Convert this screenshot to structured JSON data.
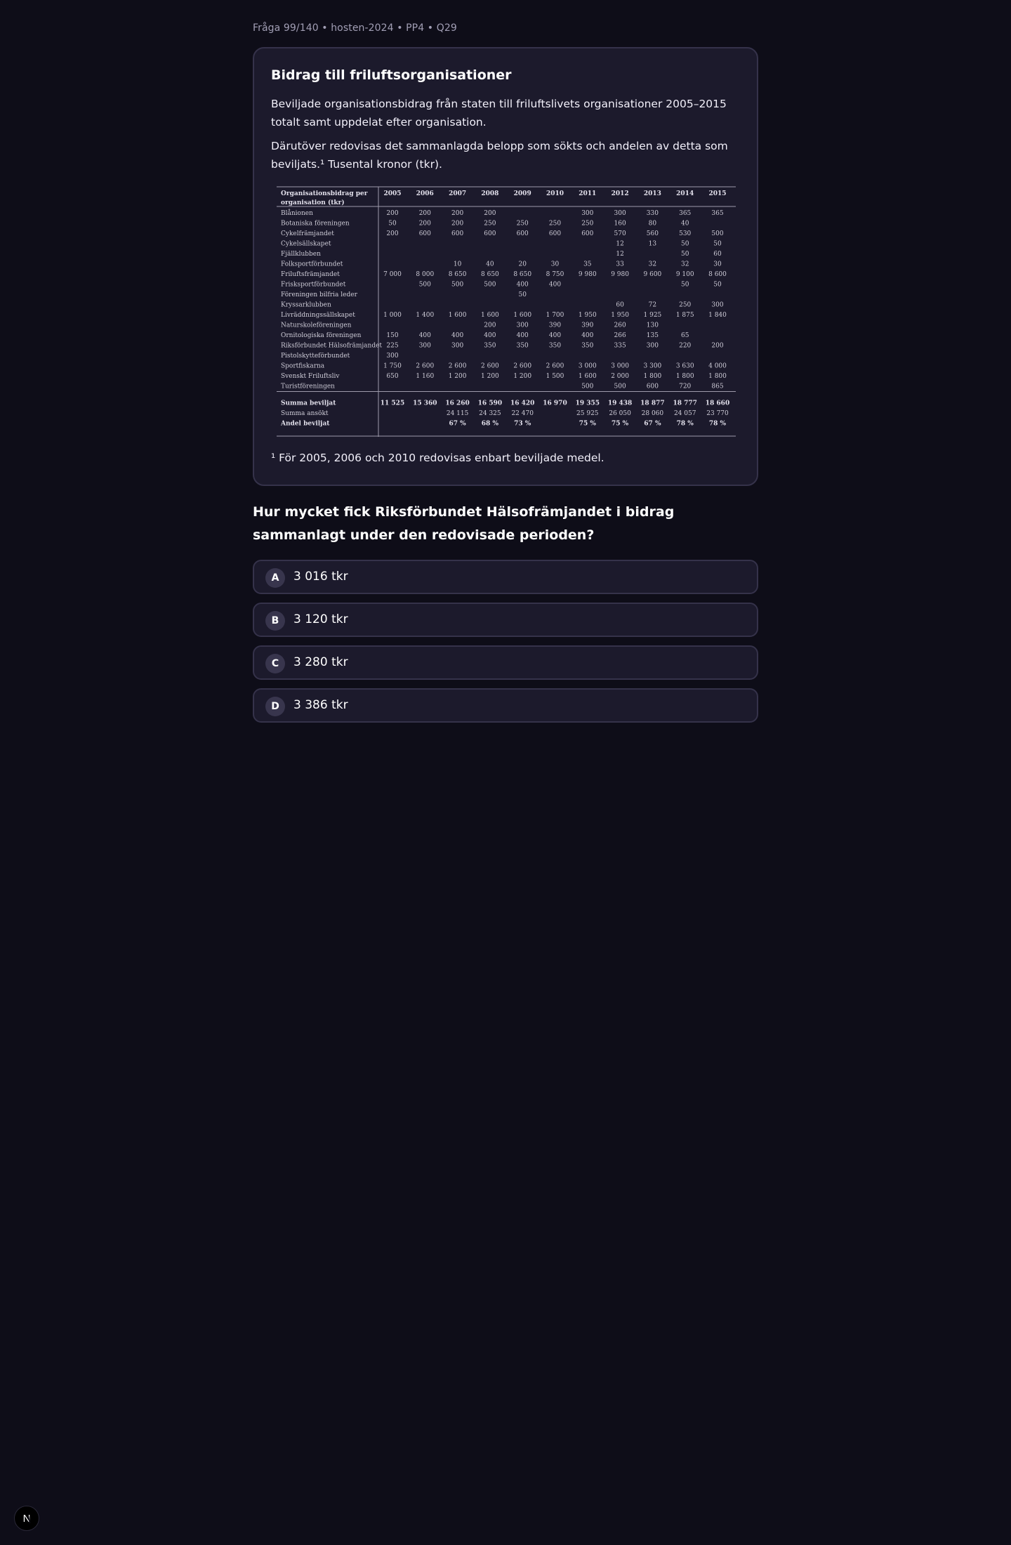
{
  "meta": "Fråga 99/140 • hosten-2024 • PP4 • Q29",
  "card": {
    "title": "Bidrag till friluftsorganisationer",
    "paragraph1": "Beviljade organisationsbidrag från staten till friluftslivets organisationer 2005–2015 totalt samt uppdelat efter organisation.",
    "paragraph2": "Därutöver redovisas det sammanlagda belopp som sökts och andelen av detta som beviljats.¹ Tusental kronor (tkr).",
    "footnote": "¹ För 2005, 2006 och 2010 redovisas enbart beviljade medel."
  },
  "table": {
    "header_line1": "Organisationsbidrag per",
    "header_line2": "organisation  (tkr)",
    "years": [
      "2005",
      "2006",
      "2007",
      "2008",
      "2009",
      "2010",
      "2011",
      "2012",
      "2013",
      "2014",
      "2015"
    ],
    "rows": [
      {
        "name": "Blånionen",
        "values": [
          "200",
          "200",
          "200",
          "200",
          "",
          "",
          "300",
          "300",
          "330",
          "365",
          "365"
        ]
      },
      {
        "name": "Botaniska föreningen",
        "values": [
          "50",
          "200",
          "200",
          "250",
          "250",
          "250",
          "250",
          "160",
          "80",
          "40",
          ""
        ]
      },
      {
        "name": "Cykelfrämjandet",
        "values": [
          "200",
          "600",
          "600",
          "600",
          "600",
          "600",
          "600",
          "570",
          "560",
          "530",
          "500"
        ]
      },
      {
        "name": "Cykelsällskapet",
        "values": [
          "",
          "",
          "",
          "",
          "",
          "",
          "",
          "12",
          "13",
          "50",
          "50"
        ]
      },
      {
        "name": "Fjällklubben",
        "values": [
          "",
          "",
          "",
          "",
          "",
          "",
          "",
          "12",
          "",
          "50",
          "60"
        ]
      },
      {
        "name": "Folksportförbundet",
        "values": [
          "",
          "",
          "10",
          "40",
          "20",
          "30",
          "35",
          "33",
          "32",
          "32",
          "30"
        ]
      },
      {
        "name": "Friluftsfrämjandet",
        "values": [
          "7 000",
          "8 000",
          "8 650",
          "8 650",
          "8 650",
          "8 750",
          "9 980",
          "9 980",
          "9 600",
          "9 100",
          "8 600"
        ]
      },
      {
        "name": "Frisksportförbundet",
        "values": [
          "",
          "500",
          "500",
          "500",
          "400",
          "400",
          "",
          "",
          "",
          "50",
          "50"
        ]
      },
      {
        "name": "Föreningen bilfria leder",
        "values": [
          "",
          "",
          "",
          "",
          "50",
          "",
          "",
          "",
          "",
          "",
          ""
        ]
      },
      {
        "name": "Kryssarklubben",
        "values": [
          "",
          "",
          "",
          "",
          "",
          "",
          "",
          "60",
          "72",
          "250",
          "300"
        ]
      },
      {
        "name": "Livräddningssällskapet",
        "values": [
          "1 000",
          "1 400",
          "1 600",
          "1 600",
          "1 600",
          "1 700",
          "1 950",
          "1 950",
          "1 925",
          "1 875",
          "1 840"
        ]
      },
      {
        "name": "Naturskoleföreningen",
        "values": [
          "",
          "",
          "",
          "200",
          "300",
          "390",
          "390",
          "260",
          "130",
          "",
          ""
        ]
      },
      {
        "name": "Ornitologiska föreningen",
        "values": [
          "150",
          "400",
          "400",
          "400",
          "400",
          "400",
          "400",
          "266",
          "135",
          "65",
          ""
        ]
      },
      {
        "name": "Riksförbundet Hälsofrämjandet",
        "values": [
          "225",
          "300",
          "300",
          "350",
          "350",
          "350",
          "350",
          "335",
          "300",
          "220",
          "200"
        ]
      },
      {
        "name": "Pistolskytteförbundet",
        "values": [
          "300",
          "",
          "",
          "",
          "",
          "",
          "",
          "",
          "",
          "",
          ""
        ]
      },
      {
        "name": "Sportfiskarna",
        "values": [
          "1 750",
          "2 600",
          "2 600",
          "2 600",
          "2 600",
          "2 600",
          "3 000",
          "3 000",
          "3 300",
          "3 630",
          "4 000"
        ]
      },
      {
        "name": "Svenskt Friluftsliv",
        "values": [
          "650",
          "1 160",
          "1 200",
          "1 200",
          "1 200",
          "1 500",
          "1 600",
          "2 000",
          "1 800",
          "1 800",
          "1 800"
        ]
      },
      {
        "name": "Turistföreningen",
        "values": [
          "",
          "",
          "",
          "",
          "",
          "",
          "500",
          "500",
          "600",
          "720",
          "865"
        ]
      }
    ],
    "summary": [
      {
        "name": "Summa beviljat",
        "bold": true,
        "values": [
          "11 525",
          "15 360",
          "16 260",
          "16 590",
          "16 420",
          "16 970",
          "19 355",
          "19 438",
          "18 877",
          "18 777",
          "18 660"
        ]
      },
      {
        "name": "Summa ansökt",
        "bold": false,
        "values": [
          "",
          "",
          "24 115",
          "24 325",
          "22 470",
          "",
          "25 925",
          "26 050",
          "28 060",
          "24 057",
          "23 770"
        ]
      },
      {
        "name": "Andel beviljat",
        "bold": true,
        "values": [
          "",
          "",
          "67 %",
          "68 %",
          "73 %",
          "",
          "75 %",
          "75 %",
          "67 %",
          "78 %",
          "78 %"
        ]
      }
    ]
  },
  "question": "Hur mycket fick Riksförbundet Hälsofrämjandet i bidrag sammanlagt under den redovisade perioden?",
  "options": [
    {
      "letter": "A",
      "text": "3 016 tkr"
    },
    {
      "letter": "B",
      "text": "3 120 tkr"
    },
    {
      "letter": "C",
      "text": "3 280 tkr"
    },
    {
      "letter": "D",
      "text": "3 386 tkr"
    }
  ],
  "logo_letter": "N"
}
